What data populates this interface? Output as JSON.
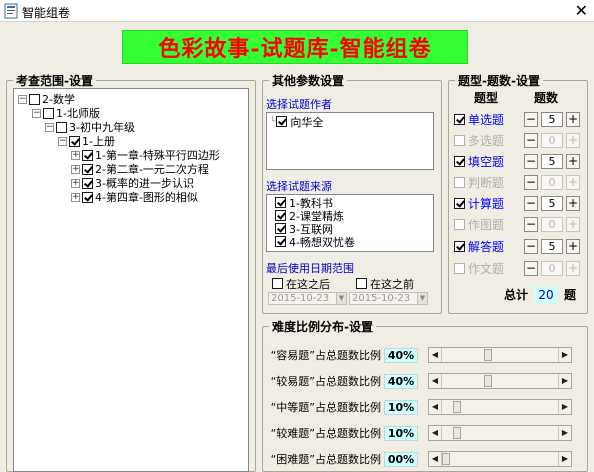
{
  "window": {
    "title": "智能组卷",
    "close_glyph": "✕"
  },
  "banner": {
    "text": "色彩故事-试题库-智能组卷"
  },
  "scope": {
    "title": "考查范围-设置",
    "tree": [
      {
        "label": "2-数学",
        "toggle": "−",
        "checked": false
      },
      {
        "label": "1-北师版",
        "toggle": "−",
        "checked": false
      },
      {
        "label": "3-初中九年级",
        "toggle": "−",
        "checked": false
      },
      {
        "label": "1-上册",
        "toggle": "−",
        "checked": true
      },
      {
        "label": "1-第一章-特殊平行四边形",
        "toggle": "+",
        "checked": true
      },
      {
        "label": "2-第二章-一元二次方程",
        "toggle": "+",
        "checked": true
      },
      {
        "label": "3-概率的进一步认识",
        "toggle": "+",
        "checked": true
      },
      {
        "label": "4-第四章-图形的相似",
        "toggle": "+",
        "checked": true
      }
    ]
  },
  "other": {
    "title": "其他参数设置",
    "author_label": "选择试题作者",
    "authors": [
      {
        "name": "向华全",
        "checked": true
      }
    ],
    "source_label": "选择试题来源",
    "sources": [
      {
        "name": "1-教科书",
        "checked": true
      },
      {
        "name": "2-课堂精炼",
        "checked": true
      },
      {
        "name": "3-互联网",
        "checked": true
      },
      {
        "name": "4-畅想双忧卷",
        "checked": true
      }
    ],
    "date_label": "最后使用日期范围",
    "after_label": "在这之后",
    "before_label": "在这之前",
    "after_date": "2015-10-23",
    "before_date": "2015-10-23"
  },
  "qtypes": {
    "title": "题型-题数-设置",
    "col_type": "题型",
    "col_count": "题数",
    "items": [
      {
        "name": "单选题",
        "enabled": true,
        "count": "5"
      },
      {
        "name": "多选题",
        "enabled": false,
        "count": "0"
      },
      {
        "name": "填空题",
        "enabled": true,
        "count": "5"
      },
      {
        "name": "判断题",
        "enabled": false,
        "count": "0"
      },
      {
        "name": "计算题",
        "enabled": true,
        "count": "5"
      },
      {
        "name": "作图题",
        "enabled": false,
        "count": "0"
      },
      {
        "name": "解答题",
        "enabled": true,
        "count": "5"
      },
      {
        "name": "作文题",
        "enabled": false,
        "count": "0"
      }
    ],
    "total_label": "总计",
    "total_value": "20",
    "total_unit": "题"
  },
  "difficulty": {
    "title": "难度比例分布-设置",
    "rows": [
      {
        "label": "“容易题”占总题数比例",
        "value": "40%",
        "fraction": 0.4
      },
      {
        "label": "“较易题”占总题数比例",
        "value": "40%",
        "fraction": 0.4
      },
      {
        "label": "“中等题”占总题数比例",
        "value": "10%",
        "fraction": 0.1
      },
      {
        "label": "“较难题”占总题数比例",
        "value": "10%",
        "fraction": 0.1
      },
      {
        "label": "“困难题”占总题数比例",
        "value": "00%",
        "fraction": 0.0
      }
    ]
  },
  "colors": {
    "banner_bg": "#33ff33",
    "banner_text": "#ff0000",
    "accent_blue": "#0000ff",
    "percent_bg": "#ccffff"
  }
}
